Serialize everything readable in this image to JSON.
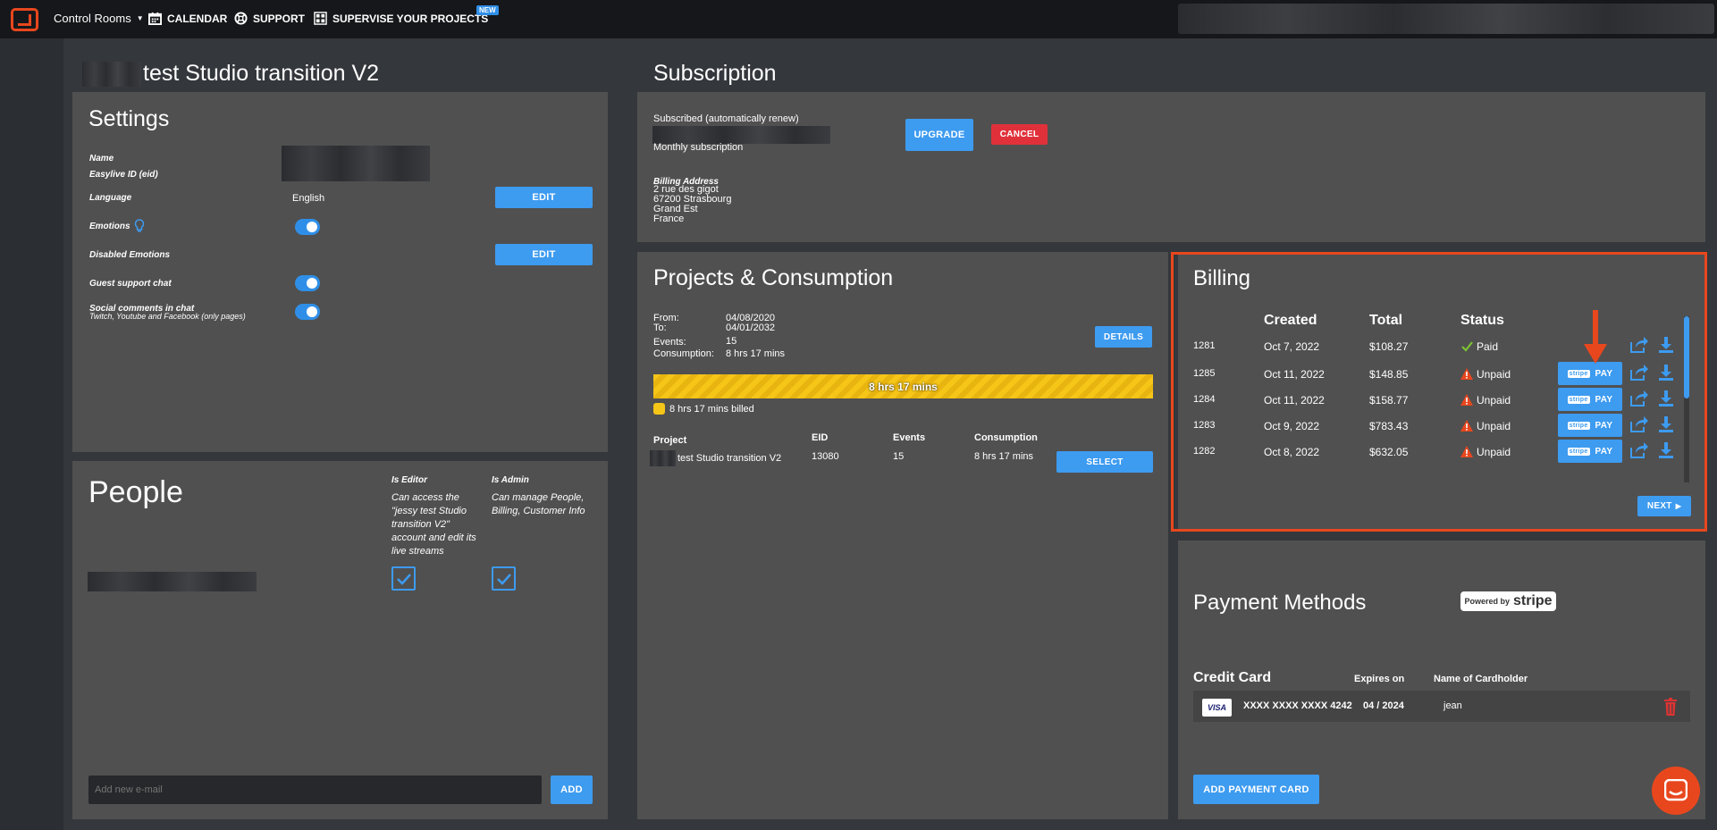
{
  "nav": {
    "control_rooms": "Control Rooms",
    "calendar": "CALENDAR",
    "support": "SUPPORT",
    "supervise": "SUPERVISE YOUR PROJECTS",
    "new_badge": "NEW"
  },
  "page_title": "test Studio transition V2",
  "settings": {
    "title": "Settings",
    "name_label": "Name",
    "eid_label": "Easylive ID (eid)",
    "language_label": "Language",
    "language_value": "English",
    "edit_label": "EDIT",
    "emotions_label": "Emotions",
    "disabled_emotions_label": "Disabled Emotions",
    "edit2_label": "EDIT",
    "guest_support_label": "Guest support chat",
    "social_label": "Social comments in chat",
    "social_sub": "Twitch, Youtube and Facebook (only pages)"
  },
  "people": {
    "title": "People",
    "is_editor": "Is Editor",
    "is_editor_desc": "Can access the \"jessy test Studio transition V2\" account and edit its live streams",
    "is_admin": "Is Admin",
    "is_admin_desc": "Can manage People, Billing, Customer Info",
    "email_placeholder": "Add new e-mail",
    "add_label": "ADD"
  },
  "subscription": {
    "title": "Subscription",
    "status": "Subscribed (automatically renew)",
    "plan": "Monthly subscription",
    "upgrade_label": "UPGRADE",
    "cancel_label": "CANCEL",
    "billing_address_label": "Billing Address",
    "address_lines": [
      "2 rue des gigot",
      "67200 Strasbourg",
      "Grand Est",
      "France"
    ]
  },
  "projects": {
    "title": "Projects & Consumption",
    "from_label": "From:",
    "from_value": "04/08/2020",
    "to_label": "To:",
    "to_value": "04/01/2032",
    "events_label": "Events:",
    "events_value": "15",
    "consumption_label": "Consumption:",
    "consumption_value": "8 hrs 17 mins",
    "details_label": "DETAILS",
    "bar_text": "8 hrs 17 mins",
    "bar_fill": 1.0,
    "billed_text": "8 hrs 17 mins billed",
    "headers": {
      "project": "Project",
      "eid": "EID",
      "events": "Events",
      "consumption": "Consumption"
    },
    "row": {
      "project": "test Studio transition V2",
      "eid": "13080",
      "events": "15",
      "consumption": "8 hrs 17 mins"
    },
    "select_label": "SELECT"
  },
  "billing": {
    "title": "Billing",
    "headers": {
      "created": "Created",
      "total": "Total",
      "status": "Status"
    },
    "rows": [
      {
        "id": "1281",
        "created": "Oct 7, 2022",
        "total": "$108.27",
        "status": "Paid"
      },
      {
        "id": "1285",
        "created": "Oct 11, 2022",
        "total": "$148.85",
        "status": "Unpaid"
      },
      {
        "id": "1284",
        "created": "Oct 11, 2022",
        "total": "$158.77",
        "status": "Unpaid"
      },
      {
        "id": "1283",
        "created": "Oct 9, 2022",
        "total": "$783.43",
        "status": "Unpaid"
      },
      {
        "id": "1282",
        "created": "Oct 8, 2022",
        "total": "$632.05",
        "status": "Unpaid"
      }
    ],
    "pay_label": "PAY",
    "stripe_small": "stripe",
    "next_label": "NEXT",
    "highlight_color": "#e8471e"
  },
  "payment": {
    "title": "Payment Methods",
    "powered_by": "Powered by",
    "stripe": "stripe",
    "credit_card_label": "Credit Card",
    "expires_label": "Expires on",
    "cardholder_label": "Name of Cardholder",
    "card_brand": "VISA",
    "card_number": "XXXX XXXX XXXX 4242",
    "expiry": "04 / 2024",
    "cardholder": "jean",
    "add_card_label": "ADD PAYMENT CARD"
  }
}
